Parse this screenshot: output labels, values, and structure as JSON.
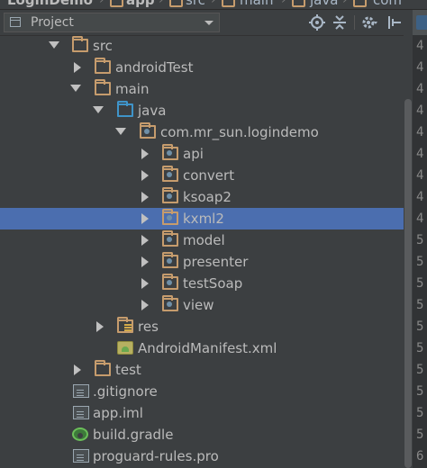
{
  "breadcrumbs": [
    {
      "label": "LoginDemo",
      "bold": true
    },
    {
      "label": "app",
      "bold": true
    },
    {
      "label": "src",
      "bold": false
    },
    {
      "label": "main",
      "bold": false
    },
    {
      "label": "java",
      "bold": false
    },
    {
      "label": "com",
      "bold": false
    }
  ],
  "panel": {
    "title": "Project",
    "icons": [
      "target-icon",
      "collapse-all-icon",
      "settings-icon",
      "hide-panel-icon"
    ]
  },
  "tree": [
    {
      "label": "src",
      "level": 0,
      "expanded": true,
      "icon": "folder"
    },
    {
      "label": "androidTest",
      "level": 1,
      "expanded": false,
      "icon": "folder"
    },
    {
      "label": "main",
      "level": 1,
      "expanded": true,
      "icon": "folder"
    },
    {
      "label": "java",
      "level": 2,
      "expanded": true,
      "icon": "source-folder"
    },
    {
      "label": "com.mr_sun.logindemo",
      "level": 3,
      "expanded": true,
      "icon": "package"
    },
    {
      "label": "api",
      "level": 4,
      "expanded": false,
      "icon": "package"
    },
    {
      "label": "convert",
      "level": 4,
      "expanded": false,
      "icon": "package"
    },
    {
      "label": "ksoap2",
      "level": 4,
      "expanded": false,
      "icon": "package"
    },
    {
      "label": "kxml2",
      "level": 4,
      "expanded": false,
      "icon": "package",
      "selected": true
    },
    {
      "label": "model",
      "level": 4,
      "expanded": false,
      "icon": "package"
    },
    {
      "label": "presenter",
      "level": 4,
      "expanded": false,
      "icon": "package"
    },
    {
      "label": "testSoap",
      "level": 4,
      "expanded": false,
      "icon": "package"
    },
    {
      "label": "view",
      "level": 4,
      "expanded": false,
      "icon": "package"
    },
    {
      "label": "res",
      "level": 2,
      "expanded": false,
      "icon": "resource-folder"
    },
    {
      "label": "AndroidManifest.xml",
      "level": 2,
      "expanded": null,
      "icon": "manifest"
    },
    {
      "label": "test",
      "level": 1,
      "expanded": false,
      "icon": "folder"
    },
    {
      "label": ".gitignore",
      "level": 0,
      "expanded": null,
      "icon": "text-file"
    },
    {
      "label": "app.iml",
      "level": 0,
      "expanded": null,
      "icon": "text-file"
    },
    {
      "label": "build.gradle",
      "level": 0,
      "expanded": null,
      "icon": "gradle"
    },
    {
      "label": "proguard-rules.pro",
      "level": 0,
      "expanded": null,
      "icon": "text-file"
    }
  ],
  "gutter_numbers": [
    "4",
    "4",
    "4",
    "4",
    "4",
    "4",
    "4",
    "4",
    "4",
    "5",
    "5",
    "5",
    "5",
    "5",
    "5",
    "5",
    "5",
    "5",
    "5",
    "6",
    "6"
  ],
  "colors": {
    "selection": "#4b6eaf",
    "background": "#3c3f41",
    "folder": "#c69c6d",
    "source_root": "#3f94c9"
  }
}
